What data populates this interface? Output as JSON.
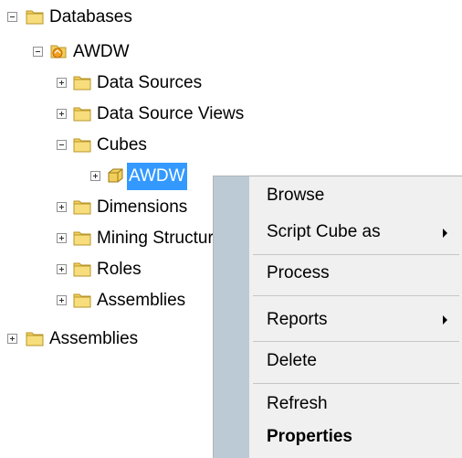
{
  "tree": {
    "databases": "Databases",
    "awdw_db": "AWDW",
    "data_sources": "Data Sources",
    "data_source_views": "Data Source Views",
    "cubes": "Cubes",
    "awdw_cube": "AWDW",
    "dimensions": "Dimensions",
    "mining_structures": "Mining Structures",
    "roles": "Roles",
    "assemblies_inner": "Assemblies",
    "assemblies_outer": "Assemblies"
  },
  "context_menu": {
    "items": [
      {
        "label": "Browse"
      },
      {
        "label": "Script Cube as",
        "submenu": true
      },
      {
        "label": "Process"
      },
      {
        "label": "Reports",
        "submenu": true
      },
      {
        "label": "Delete"
      },
      {
        "label": "Refresh"
      },
      {
        "label": "Properties",
        "bold": true
      }
    ]
  },
  "colors": {
    "selection": "#3399ff",
    "folder": "#f2cf5b",
    "menu_gutter": "#bccad6",
    "menu_background": "#f0f0f0"
  }
}
